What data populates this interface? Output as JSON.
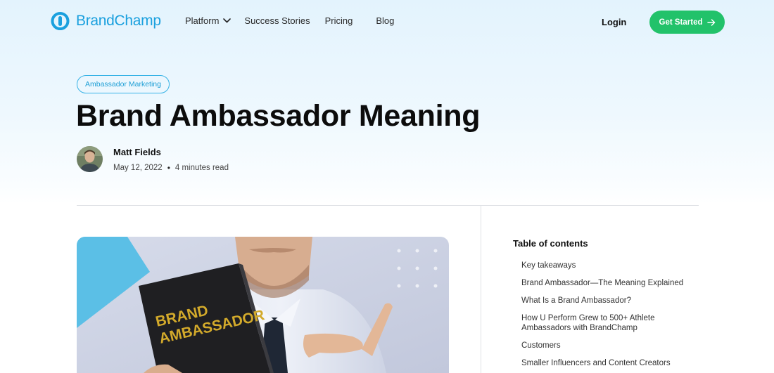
{
  "nav": {
    "logo_text": "BrandChamp",
    "links": [
      "Platform",
      "Success Stories",
      "Pricing",
      "Blog"
    ],
    "login": "Login",
    "cta": "Get Started"
  },
  "article": {
    "category": "Ambassador Marketing",
    "title": "Brand Ambassador Meaning",
    "author": "Matt Fields",
    "date": "May 12, 2022",
    "separator": "•",
    "read_time": "4 minutes read",
    "hero_book_text": [
      "BRAND",
      "AMBASSADOR"
    ]
  },
  "toc": {
    "title": "Table of contents",
    "items": [
      "Key takeaways",
      "Brand Ambassador—The Meaning Explained",
      "What Is a Brand Ambassador?",
      "How U Perform Grew to 500+ Athlete Ambassadors with BrandChamp",
      "Customers",
      "Smaller Influencers and Content Creators"
    ]
  },
  "colors": {
    "brand_blue": "#1aa0de",
    "cta_green": "#22c26a",
    "tag_border": "#36b2e6"
  },
  "icons": [
    "brandchamp-logo-icon",
    "chevron-down-icon",
    "arrow-right-icon"
  ]
}
